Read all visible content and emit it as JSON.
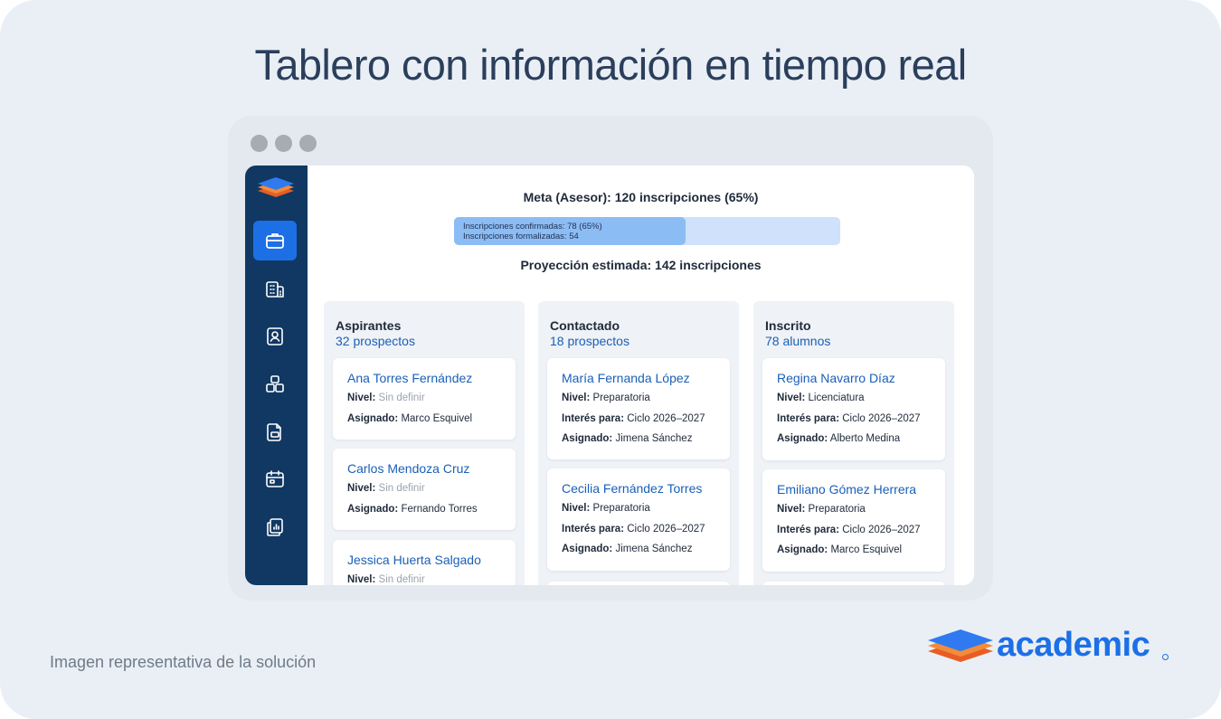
{
  "headline": "Tablero con información en tiempo real",
  "caption": "Imagen representativa de la solución",
  "brand": {
    "name": "academic",
    "icon": "academic-logo-icon",
    "color": "#1d6fe6"
  },
  "sidebar": {
    "logo_icon": "academic-logo-icon",
    "items": [
      {
        "icon": "briefcase-icon",
        "active": true
      },
      {
        "icon": "building-icon",
        "active": false
      },
      {
        "icon": "contact-book-icon",
        "active": false
      },
      {
        "icon": "boxes-icon",
        "active": false
      },
      {
        "icon": "document-icon",
        "active": false
      },
      {
        "icon": "calendar-icon",
        "active": false
      },
      {
        "icon": "report-chart-icon",
        "active": false
      }
    ]
  },
  "goal": {
    "title": "Meta (Asesor): 120 inscripciones (65%)",
    "progress": 0.6,
    "confirmed_text": "Inscripciones confirmadas: 78 (65%)",
    "formalized_text": "Inscripciones formalizadas: 54",
    "projection": "Proyección estimada: 142 inscripciones"
  },
  "columns": [
    {
      "title": "Aspirantes",
      "count": "32 prospectos",
      "cards": [
        {
          "name": "Ana Torres Fernández",
          "fields": [
            {
              "label": "Nivel:",
              "value": "Sin definir",
              "muted": true
            },
            {
              "label": "Asignado:",
              "value": "Marco Esquivel"
            }
          ]
        },
        {
          "name": "Carlos Mendoza Cruz",
          "fields": [
            {
              "label": "Nivel:",
              "value": "Sin definir",
              "muted": true
            },
            {
              "label": "Asignado:",
              "value": "Fernando Torres"
            }
          ]
        },
        {
          "name": "Jessica Huerta Salgado",
          "fields": [
            {
              "label": "Nivel:",
              "value": "Sin definir",
              "muted": true
            }
          ]
        }
      ]
    },
    {
      "title": "Contactado",
      "count": "18 prospectos",
      "cards": [
        {
          "name": "María Fernanda López",
          "fields": [
            {
              "label": "Nivel:",
              "value": "Preparatoria"
            },
            {
              "label": "Interés para:",
              "value": "Ciclo 2026–2027"
            },
            {
              "label": "Asignado:",
              "value": "Jimena Sánchez"
            }
          ]
        },
        {
          "name": "Cecilia Fernández Torres",
          "fields": [
            {
              "label": "Nivel:",
              "value": "Preparatoria"
            },
            {
              "label": "Interés para:",
              "value": "Ciclo 2026–2027"
            },
            {
              "label": "Asignado:",
              "value": "Jimena Sánchez"
            }
          ]
        }
      ]
    },
    {
      "title": "Inscrito",
      "count": "78 alumnos",
      "cards": [
        {
          "name": "Regina Navarro Díaz",
          "fields": [
            {
              "label": "Nivel:",
              "value": "Licenciatura"
            },
            {
              "label": "Interés para:",
              "value": "Ciclo 2026–2027"
            },
            {
              "label": "Asignado:",
              "value": "Alberto Medina"
            }
          ]
        },
        {
          "name": "Emiliano Gómez Herrera",
          "fields": [
            {
              "label": "Nivel:",
              "value": "Preparatoria"
            },
            {
              "label": "Interés para:",
              "value": "Ciclo 2026–2027"
            },
            {
              "label": "Asignado:",
              "value": "Marco Esquivel"
            }
          ]
        }
      ]
    }
  ]
}
